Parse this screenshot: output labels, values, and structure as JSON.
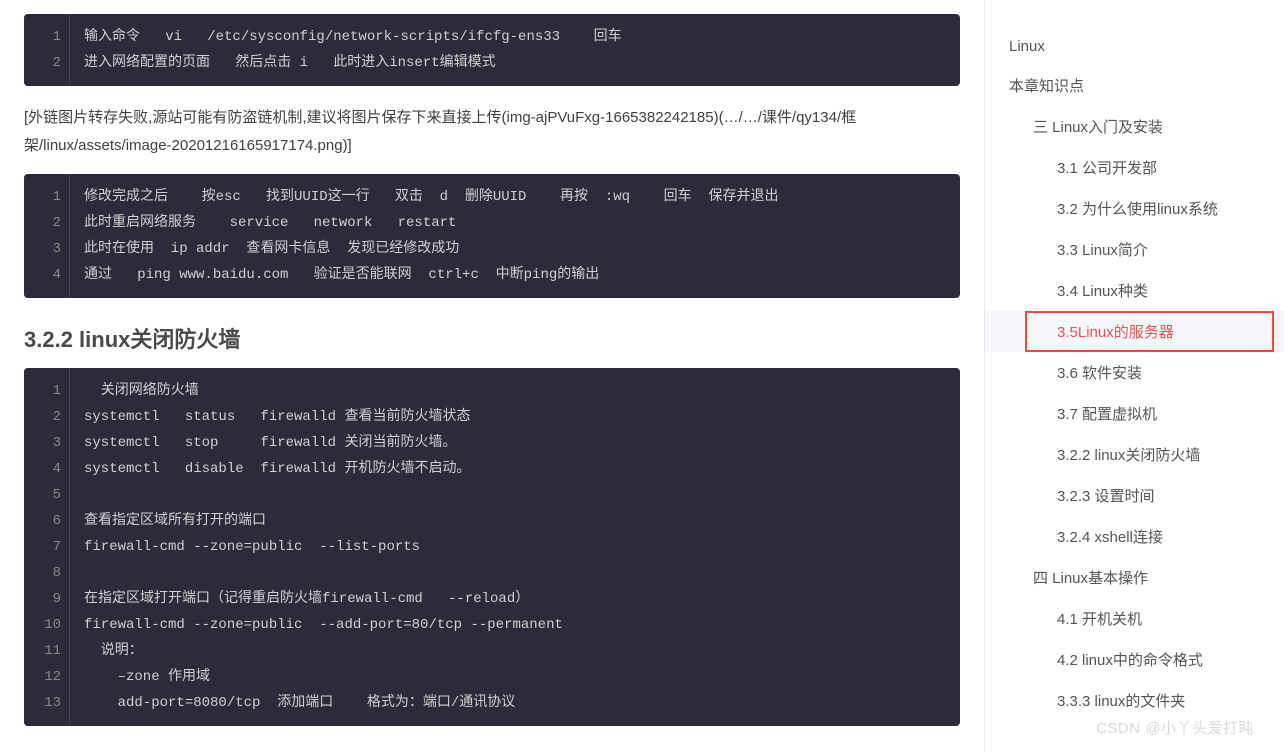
{
  "code1": {
    "lines": [
      "1",
      "2"
    ],
    "text": "输入命令   vi   /etc/sysconfig/network-scripts/ifcfg-ens33    回车\n进入网络配置的页面   然后点击 i   此时进入insert编辑模式"
  },
  "note_img": "[外链图片转存失败,源站可能有防盗链机制,建议将图片保存下来直接上传(img-ajPVuFxg-1665382242185)(…/…/课件/qy134/框架/linux/assets/image-20201216165917174.png)]",
  "code2": {
    "lines": [
      "1",
      "2",
      "3",
      "4"
    ],
    "text": "修改完成之后    按esc   找到UUID这一行   双击  d  删除UUID    再按  :wq    回车  保存并退出\n此时重启网络服务    service   network   restart\n此时在使用  ip addr  查看网卡信息  发现已经修改成功\n通过   ping www.baidu.com   验证是否能联网  ctrl+c  中断ping的输出"
  },
  "heading": "3.2.2 linux关闭防火墙",
  "code3": {
    "lines": [
      "1",
      "2",
      "3",
      "4",
      "5",
      "6",
      "7",
      "8",
      "9",
      "10",
      "11",
      "12",
      "13"
    ],
    "text": "  关闭网络防火墙\nsystemctl   status   firewalld 查看当前防火墙状态\nsystemctl   stop     firewalld 关闭当前防火墙。\nsystemctl   disable  firewalld 开机防火墙不启动。\n\n查看指定区域所有打开的端口\nfirewall-cmd --zone=public  --list-ports\n\n在指定区域打开端口（记得重启防火墙firewall-cmd   --reload）\nfirewall-cmd --zone=public  --add-port=80/tcp --permanent\n  说明：\n    –zone 作用域\n    add-port=8080/tcp  添加端口    格式为：端口/通讯协议"
  },
  "toc": [
    {
      "level": 1,
      "label": "Linux"
    },
    {
      "level": 1,
      "label": "本章知识点"
    },
    {
      "level": 2,
      "label": "三 Linux入门及安装"
    },
    {
      "level": 3,
      "label": "3.1 公司开发部"
    },
    {
      "level": 3,
      "label": "3.2 为什么使用linux系统"
    },
    {
      "level": 3,
      "label": "3.3 Linux简介"
    },
    {
      "level": 3,
      "label": "3.4 Linux种类"
    },
    {
      "level": 3,
      "label": "3.5Linux的服务器",
      "active": true
    },
    {
      "level": 3,
      "label": "3.6 软件安装"
    },
    {
      "level": 3,
      "label": "3.7 配置虚拟机"
    },
    {
      "level": 3,
      "label": "3.2.2 linux关闭防火墙"
    },
    {
      "level": 3,
      "label": "3.2.3 设置时间"
    },
    {
      "level": 3,
      "label": "3.2.4 xshell连接"
    },
    {
      "level": 2,
      "label": "四 Linux基本操作"
    },
    {
      "level": 3,
      "label": "4.1 开机关机"
    },
    {
      "level": 3,
      "label": "4.2 linux中的命令格式"
    },
    {
      "level": 3,
      "label": "3.3.3 linux的文件夹"
    }
  ],
  "watermark": "CSDN @小丫头爱打盹"
}
